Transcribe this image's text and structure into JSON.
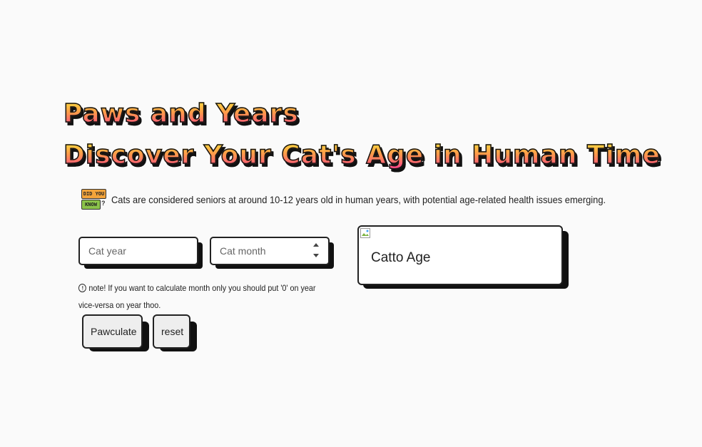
{
  "header": {
    "title_line1": "Paws and Years",
    "title_line2": "Discover Your Cat's Age in Human Time"
  },
  "fact": {
    "badge_top": "DID YOU",
    "badge_bottom": "KNOW",
    "badge_mark": "?",
    "text": "Cats are considered seniors at around 10-12 years old in human years, with potential age-related health issues emerging."
  },
  "form": {
    "year_placeholder": "Cat year",
    "month_placeholder": "Cat month",
    "note": "note! If you want to calculate month only you should put '0' on year vice-versa on year thoo.",
    "calculate_label": "Pawculate",
    "reset_label": "reset"
  },
  "result": {
    "label": "Catto Age"
  },
  "icons": {
    "note": "info-icon",
    "result_image": "broken-image-icon",
    "badge": "did-you-know-badge"
  },
  "colors": {
    "title_gradient_top": "#ffe53b",
    "title_gradient_bottom": "#ff3f8e",
    "shadow": "#111111",
    "button_bg": "#eeeeee"
  }
}
